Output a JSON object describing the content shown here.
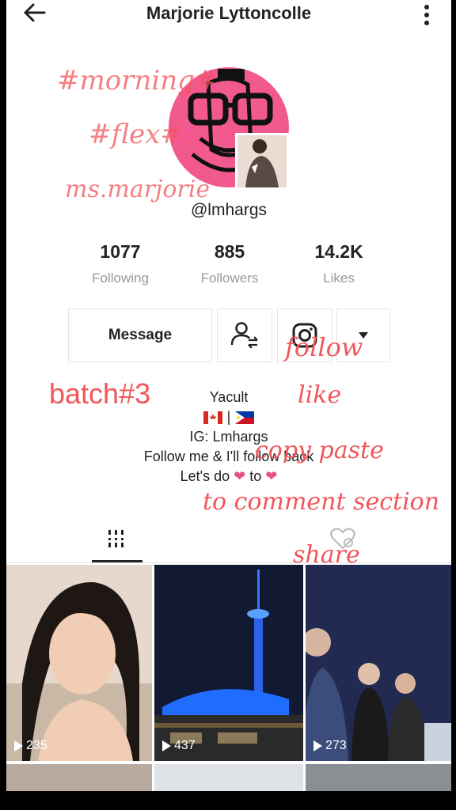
{
  "header": {
    "title": "Marjorie Lyttoncolle"
  },
  "profile": {
    "handle": "@lmhargs"
  },
  "stats": [
    {
      "value": "1077",
      "label": "Following"
    },
    {
      "value": "885",
      "label": "Followers"
    },
    {
      "value": "14.2K",
      "label": "Likes"
    }
  ],
  "actions": {
    "message_label": "Message"
  },
  "bio": {
    "line1": "Yacult",
    "line2_sep": "|",
    "line3": "IG: Lmhargs",
    "line4": "Follow me & I'll follow back",
    "line5_a": "Let's do",
    "line5_b": "to"
  },
  "videos": [
    {
      "views": "235"
    },
    {
      "views": "437"
    },
    {
      "views": "273"
    }
  ],
  "overlay": {
    "morning": "#morning#",
    "flex": "#flex#",
    "name": "ms.marjorie",
    "batch": "batch#3",
    "follow": "follow",
    "like": "like",
    "copy": "copy paste",
    "comment": "to comment section",
    "share": "share"
  },
  "colors": {
    "accent": "#f2555a",
    "avatar_bg": "#f25a8f",
    "heart": "#e84f8d"
  }
}
